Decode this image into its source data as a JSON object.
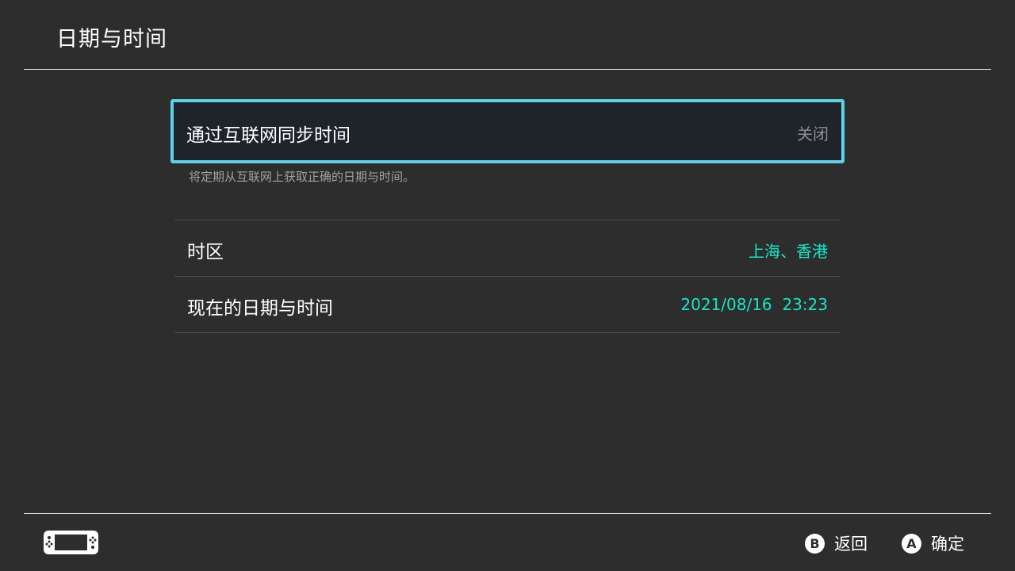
{
  "header": {
    "title": "日期与时间"
  },
  "settings": {
    "sync": {
      "label": "通过互联网同步时间",
      "value": "关闭",
      "description": "将定期从互联网上获取正确的日期与时间。"
    },
    "timezone": {
      "label": "时区",
      "value": "上海、香港"
    },
    "current_datetime": {
      "label": "现在的日期与时间",
      "value": "2021/08/16  23:23"
    }
  },
  "footer": {
    "back": {
      "key": "B",
      "label": "返回"
    },
    "confirm": {
      "key": "A",
      "label": "确定"
    },
    "console_icon": "handheld-console-icon"
  },
  "colors": {
    "background": "#2d2d2d",
    "focus_border": "#5ad3e6",
    "value_accent": "#14e6c7",
    "inactive_value": "#8c8c8c"
  }
}
